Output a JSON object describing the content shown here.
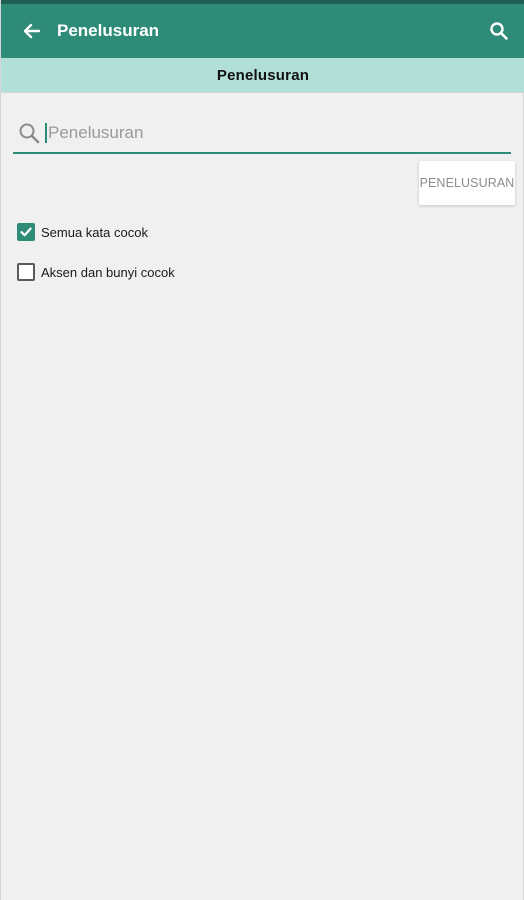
{
  "app_bar": {
    "title": "Penelusuran",
    "back_icon": "arrow-left-icon",
    "search_icon": "search-icon",
    "color": "#2e8b78"
  },
  "sub_header": {
    "title": "Penelusuran",
    "color": "#b3dfd9"
  },
  "search": {
    "placeholder": "Penelusuran",
    "value": "",
    "icon": "magnifier-icon"
  },
  "action_button": {
    "label": "PENELUSURAN"
  },
  "options": [
    {
      "label": "Semua kata cocok",
      "checked": true
    },
    {
      "label": "Aksen dan bunyi cocok",
      "checked": false
    }
  ]
}
